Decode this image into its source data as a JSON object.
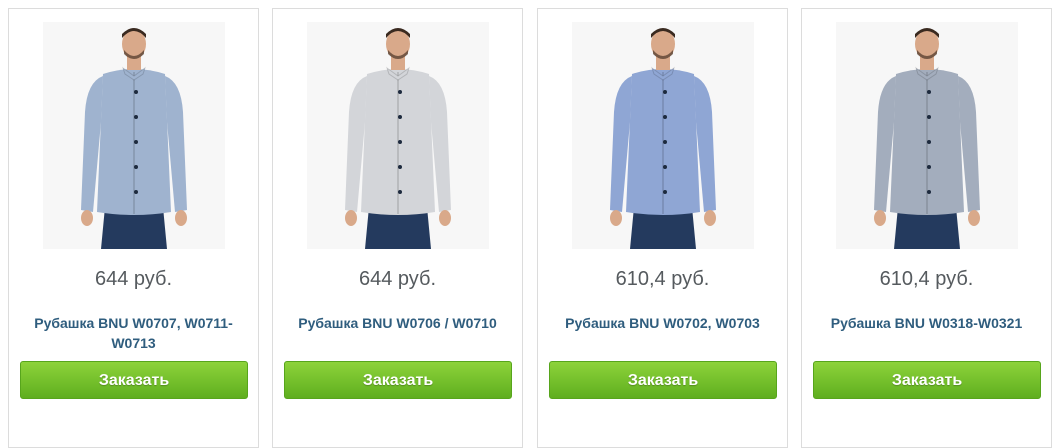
{
  "products": [
    {
      "price": "644 руб.",
      "title": "Рубашка BNU W0707, W0711-W0713",
      "button": "Заказать",
      "image_icon": "shirt-photo-icon",
      "shirt_color": "#9fb3cf"
    },
    {
      "price": "644 руб.",
      "title": "Рубашка BNU W0706 / W0710",
      "button": "Заказать",
      "image_icon": "shirt-photo-icon",
      "shirt_color": "#d3d5d9"
    },
    {
      "price": "610,4 руб.",
      "title": "Рубашка BNU W0702, W0703",
      "button": "Заказать",
      "image_icon": "shirt-photo-icon",
      "shirt_color": "#8fa6d4"
    },
    {
      "price": "610,4 руб.",
      "title": "Рубашка BNU W0318-W0321",
      "button": "Заказать",
      "image_icon": "shirt-photo-icon",
      "shirt_color": "#a3adbd"
    }
  ]
}
